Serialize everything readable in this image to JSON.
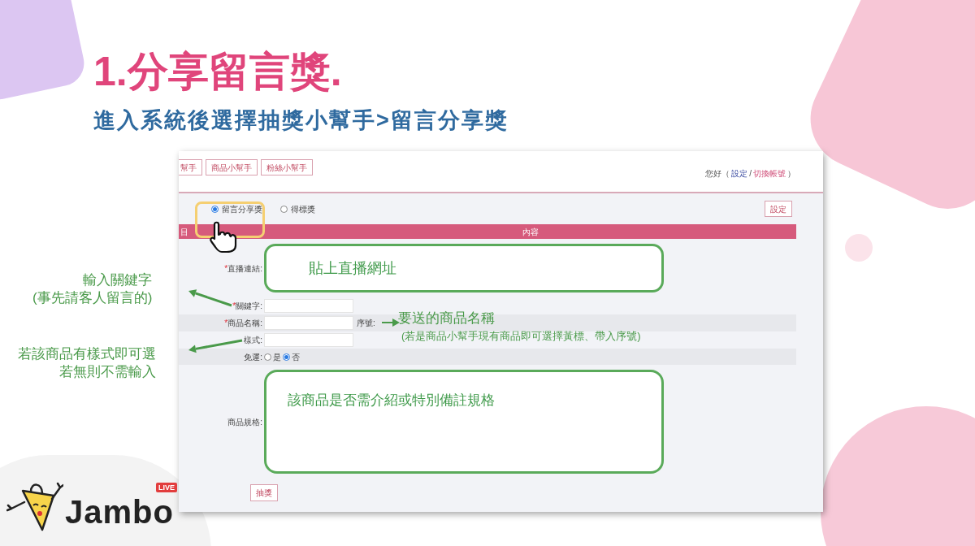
{
  "title": "1.分享留言獎.",
  "subtitle": "進入系統後選擇抽獎小幫手>留言分享獎",
  "screenshot": {
    "nav_tabs": [
      {
        "label": "幫手"
      },
      {
        "label": "商品小幫手"
      },
      {
        "label": "粉絲小幫手"
      }
    ],
    "greeting": {
      "open": "您好（",
      "settings_link": "設定",
      "separator": "/",
      "switch_link": "切換帳號",
      "close": "）"
    },
    "prize_types": [
      {
        "label": "留言分享獎",
        "selected": true
      },
      {
        "label": "得標獎",
        "selected": false
      }
    ],
    "settings_button": "設定",
    "table_header": [
      "目",
      "內容"
    ],
    "required_mark": "*",
    "fields": [
      {
        "kind": "note_box",
        "label": "直播連結:",
        "required": true,
        "note": "貼上直播網址"
      },
      {
        "kind": "text",
        "label": "關鍵字:",
        "required": true
      },
      {
        "kind": "text",
        "label": "商品名稱:",
        "required": true,
        "extra_label": "序號:"
      },
      {
        "kind": "text",
        "label": "樣式:",
        "required": false
      },
      {
        "kind": "radio",
        "label": "免運:",
        "required": false,
        "options": [
          {
            "label": "是",
            "selected": false
          },
          {
            "label": "否",
            "selected": true
          }
        ]
      },
      {
        "kind": "note_area",
        "label": "商品規格:",
        "required": false,
        "note": "該商品是否需介紹或特別備註規格"
      }
    ],
    "draw_button": "抽獎"
  },
  "callouts": [
    {
      "kind": "left",
      "lines": [
        "輸入關鍵字",
        "(事先請客人留言的)"
      ]
    },
    {
      "kind": "right",
      "lines": [
        "要送的商品名稱",
        "(若是商品小幫手現有商品即可選擇黃標、帶入序號)"
      ]
    },
    {
      "kind": "left",
      "lines": [
        "若該商品有樣式即可選",
        "若無則不需輸入"
      ]
    }
  ],
  "logo": {
    "text": "Jambo",
    "badge": "LIVE"
  }
}
